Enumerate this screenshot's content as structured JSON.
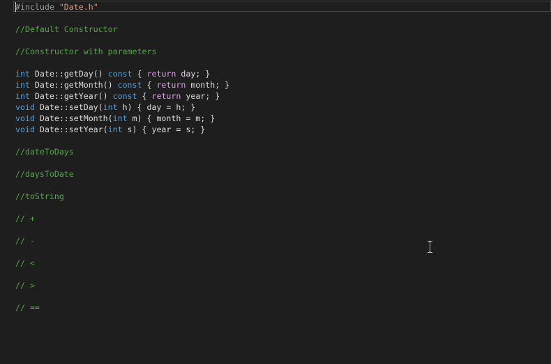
{
  "editor": {
    "lines": {
      "include": {
        "directive": "#include",
        "space": " ",
        "path": "\"Date.h\""
      },
      "blank1": "",
      "comment_default_ctor": "//Default Constructor",
      "blank2": "",
      "comment_param_ctor": "//Constructor with parameters",
      "blank3": "",
      "getDay": {
        "type": "int",
        "sig": " Date::getDay() ",
        "mod": "const",
        "open": " { ",
        "ret": "return",
        "body": " day; }"
      },
      "getMonth": {
        "type": "int",
        "sig": " Date::getMonth() ",
        "mod": "const",
        "open": " { ",
        "ret": "return",
        "body": " month; }"
      },
      "getYear": {
        "type": "int",
        "sig": " Date::getYear() ",
        "mod": "const",
        "open": " { ",
        "ret": "return",
        "body": " year; }"
      },
      "setDay": {
        "type": "void",
        "sig": " Date::setDay(",
        "ptype": "int",
        "rest": " h) { day = h; }"
      },
      "setMonth": {
        "type": "void",
        "sig": " Date::setMonth(",
        "ptype": "int",
        "rest": " m) { month = m; }"
      },
      "setYear": {
        "type": "void",
        "sig": " Date::setYear(",
        "ptype": "int",
        "rest": " s) { year = s; }"
      },
      "blank4": "",
      "comment_dateToDays": "//dateToDays",
      "blank5": "",
      "comment_daysToDate": "//daysToDate",
      "blank6": "",
      "comment_toString": "//toString",
      "blank7": "",
      "comment_plus": "// +",
      "blank8": "",
      "comment_minus": "// -",
      "blank9": "",
      "comment_less": "// <",
      "blank10": "",
      "comment_greater": "// >",
      "blank11": "",
      "comment_equal": "// =="
    }
  },
  "icons": {
    "mouse_cursor": "i-beam-cursor-icon"
  },
  "colors": {
    "background": "#1e1e1e",
    "keyword": "#569cd6",
    "control_keyword": "#d8a0df",
    "string": "#d69d85",
    "preprocessor": "#9b9b9b",
    "comment": "#57a64a",
    "text": "#dcdcdc"
  }
}
